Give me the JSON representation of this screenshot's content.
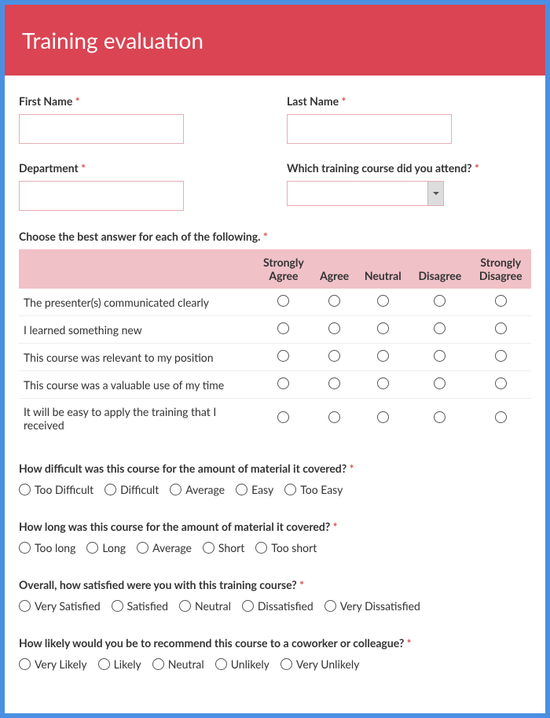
{
  "title": "Training evaluation",
  "fields": {
    "firstName": {
      "label": "First Name"
    },
    "lastName": {
      "label": "Last Name"
    },
    "department": {
      "label": "Department"
    },
    "course": {
      "label": "Which training course did you attend?"
    }
  },
  "matrix": {
    "label": "Choose the best answer for each of the following.",
    "columns": [
      "Strongly Agree",
      "Agree",
      "Neutral",
      "Disagree",
      "Strongly Disagree"
    ],
    "rows": [
      "The presenter(s) communicated clearly",
      "I learned something new",
      "This course was relevant to my position",
      "This course was a valuable use of my time",
      "It will be easy to apply the training that I received"
    ]
  },
  "questions": [
    {
      "label": "How difficult was this course for the amount of material it covered?",
      "options": [
        "Too Difficult",
        "Difficult",
        "Average",
        "Easy",
        "Too Easy"
      ]
    },
    {
      "label": "How long was this course for the amount of material it covered?",
      "options": [
        "Too long",
        "Long",
        "Average",
        "Short",
        "Too short"
      ]
    },
    {
      "label": "Overall, how satisfied were you with this training course?",
      "options": [
        "Very Satisfied",
        "Satisfied",
        "Neutral",
        "Dissatisfied",
        "Very Dissatisfied"
      ]
    },
    {
      "label": "How likely would you be to recommend this course to a coworker or colleague?",
      "options": [
        "Very Likely",
        "Likely",
        "Neutral",
        "Unlikely",
        "Very Unlikely"
      ]
    }
  ]
}
